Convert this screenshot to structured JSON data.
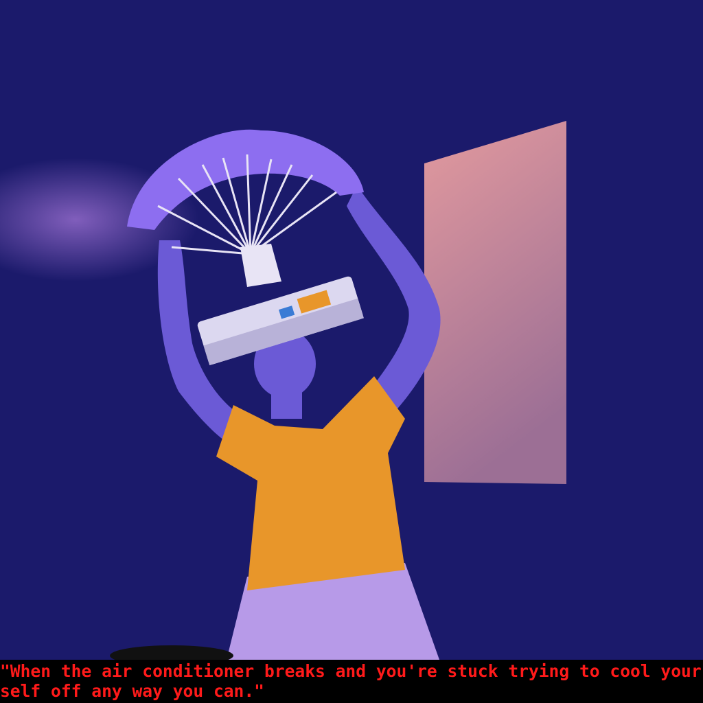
{
  "caption": "\"When the air conditioner breaks and you're stuck trying to cool yourself off any way you can.\"",
  "colors": {
    "background": "#1b1a6b",
    "skin": "#6b5ad6",
    "shirt": "#e8962a",
    "skirt": "#b79ae8",
    "panel": "#d98f9a",
    "caption_text": "#ff1a1a",
    "caption_bg": "#000000"
  }
}
